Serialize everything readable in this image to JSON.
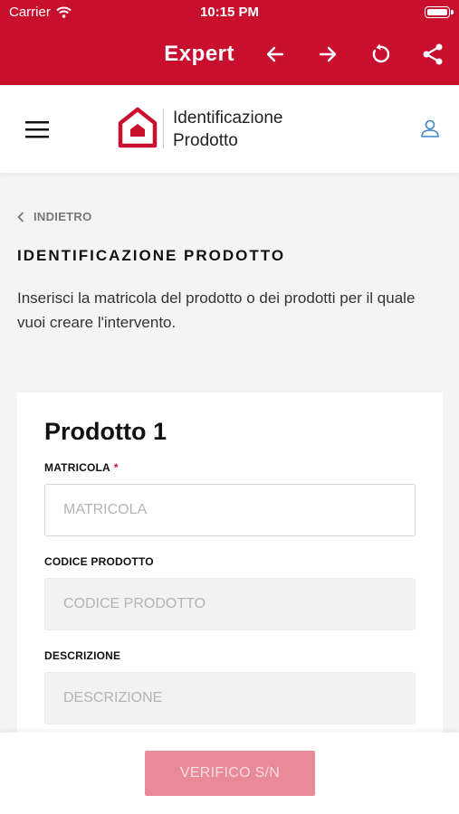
{
  "status_bar": {
    "carrier": "Carrier",
    "time": "10:15 PM"
  },
  "toolbar": {
    "brand": "Expert"
  },
  "header": {
    "title_line1": "Identificazione",
    "title_line2": "Prodotto"
  },
  "nav": {
    "back_label": "INDIETRO"
  },
  "page": {
    "title": "IDENTIFICAZIONE PRODOTTO",
    "intro": "Inserisci la matricola del prodotto o dei prodotti per il quale vuoi creare l'intervento."
  },
  "product_card": {
    "heading": "Prodotto 1",
    "fields": [
      {
        "label": "MATRICOLA",
        "required_mark": "*",
        "placeholder": "MATRICOLA"
      },
      {
        "label": "CODICE PRODOTTO",
        "placeholder": "CODICE PRODOTTO"
      },
      {
        "label": "DESCRIZIONE",
        "placeholder": "DESCRIZIONE"
      }
    ]
  },
  "footer": {
    "verify_button": "VERIFICO S/N"
  },
  "colors": {
    "brand_red": "#c8102e",
    "disabled_button": "#e88a98",
    "user_icon": "#3a86c8"
  }
}
